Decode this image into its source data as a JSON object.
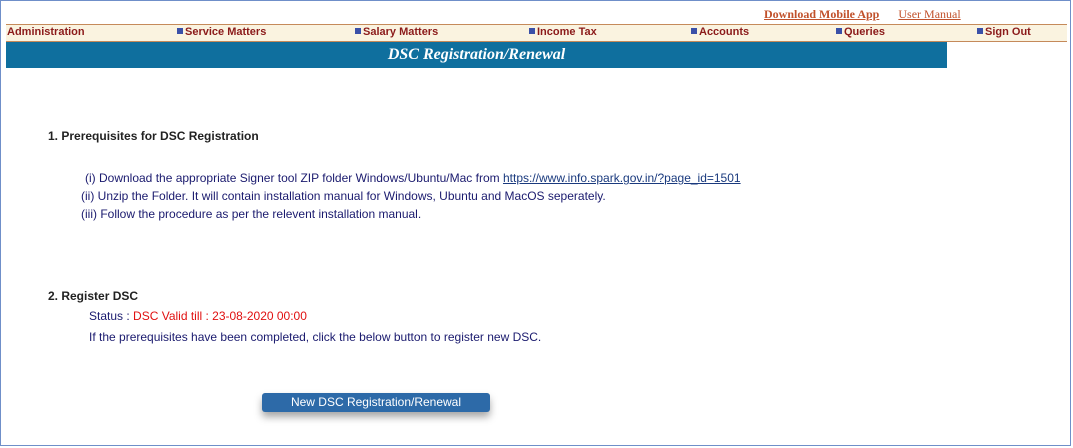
{
  "top_links": {
    "download_app": "Download Mobile App",
    "user_manual": "User Manual"
  },
  "menu": [
    "Administration",
    "Service Matters",
    "Salary Matters",
    "Income Tax",
    "Accounts",
    "Queries",
    "Sign Out"
  ],
  "page_title": "DSC Registration/Renewal",
  "section1": {
    "heading": "1. Prerequisites for DSC Registration",
    "steps": [
      "(i)  Download the appropriate Signer tool ZIP folder Windows/Ubuntu/Mac from ",
      "(ii)  Unzip the Folder. It will contain installation manual for Windows, Ubuntu and MacOS seperately.",
      "(iii) Follow the procedure as per the relevent installation manual."
    ],
    "link": "https://www.info.spark.gov.in/?page_id=1501"
  },
  "section2": {
    "heading": "2. Register DSC",
    "status_label": "Status : ",
    "status_value": "DSC Valid till : 23-08-2020 00:00",
    "info": "If the prerequisites have been completed, click the below button to register new DSC.",
    "button": "New DSC Registration/Renewal"
  },
  "colors": {
    "title_bar": "#0f6f9e",
    "menu_text": "#8b1a1a",
    "status_value": "#e01010",
    "button": "#2d6aa8"
  }
}
